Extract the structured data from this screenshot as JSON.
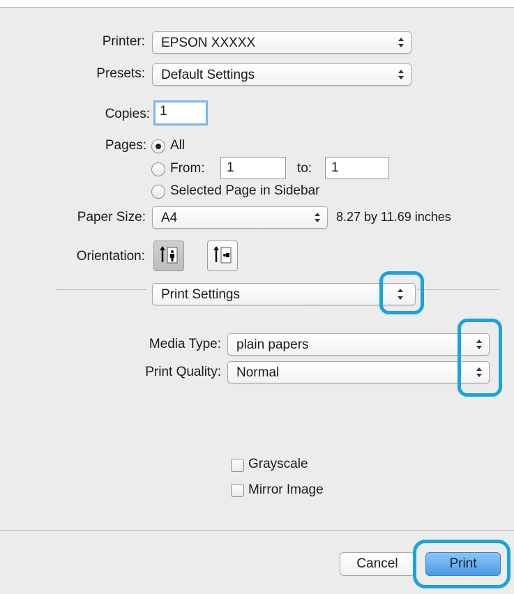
{
  "printer": {
    "label": "Printer:",
    "value": "EPSON XXXXX"
  },
  "presets": {
    "label": "Presets:",
    "value": "Default Settings"
  },
  "copies": {
    "label": "Copies:",
    "value": "1"
  },
  "pages": {
    "label": "Pages:",
    "all_label": "All",
    "from_label": "From:",
    "from_value": "1",
    "to_label": "to:",
    "to_value": "1",
    "selected_label": "Selected Page in Sidebar"
  },
  "paper_size": {
    "label": "Paper Size:",
    "value": "A4",
    "dimensions": "8.27 by 11.69 inches"
  },
  "orientation": {
    "label": "Orientation:",
    "selected": "portrait"
  },
  "panel_select": {
    "value": "Print Settings"
  },
  "media_type": {
    "label": "Media Type:",
    "value": "plain papers"
  },
  "print_quality": {
    "label": "Print Quality:",
    "value": "Normal"
  },
  "options": {
    "grayscale_label": "Grayscale",
    "mirror_label": "Mirror Image"
  },
  "buttons": {
    "cancel_label": "Cancel",
    "print_label": "Print"
  },
  "colors": {
    "highlight": "#1ba3dc",
    "default_button": "#4b9be6",
    "dialog_bg": "#ececec"
  }
}
